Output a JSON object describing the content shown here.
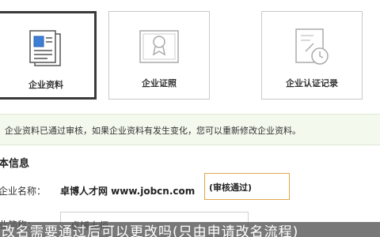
{
  "tiles": [
    {
      "label": "企业资料",
      "icon": "document-icon",
      "active": true
    },
    {
      "label": "企业证照",
      "icon": "license-icon",
      "active": false
    },
    {
      "label": "企业认证记录",
      "icon": "certificate-icon",
      "active": false
    }
  ],
  "notice": {
    "text": "企业资料已通过审核，如果企业资料有发生变化，您可以重新修改企业资料。"
  },
  "section": {
    "title": "本信息"
  },
  "company": {
    "name_label": "企业名称：",
    "name_value": "卓博人才网 www.jobcn.com",
    "status": "(审核通过)"
  },
  "abbr": {
    "label": "业简称：",
    "value": "卓博大师"
  },
  "caption": {
    "text": "改名需要通过后可以更改吗(只由申请改名流程)"
  },
  "colors": {
    "active_border": "#3a3a3a",
    "notice_bg": "#f4f9ee",
    "status_border": "#e0a64a",
    "icon_blue": "#3d7fd6"
  }
}
